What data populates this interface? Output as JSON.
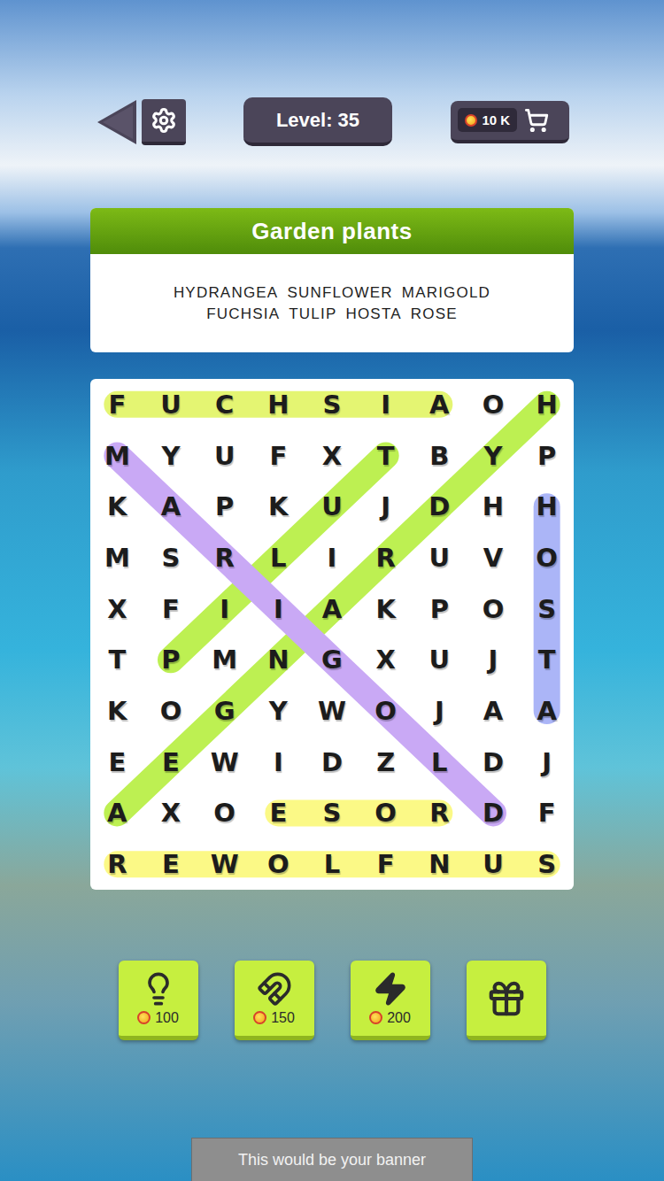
{
  "level": {
    "label": "Level: 35"
  },
  "coins": {
    "amount": "10 K"
  },
  "puzzle": {
    "title": "Garden plants",
    "word_rows": [
      [
        "HYDRANGEA",
        "SUNFLOWER",
        "MARIGOLD"
      ],
      [
        "FUCHSIA",
        "TULIP",
        "HOSTA",
        "ROSE"
      ]
    ]
  },
  "grid": {
    "rows": [
      "FUCHSIAOH",
      "MYUFXTBYP",
      "KAPKUJDHH",
      "MSRLIRUVO",
      "XFIIAKPOS",
      "TPMNGXUJT",
      "KOGYWOJAA",
      "EEWIDZLDJ",
      "AXOESORDF",
      "REWOLFNUS"
    ]
  },
  "found": [
    {
      "word": "FUCHSIA",
      "start": [
        0,
        0
      ],
      "end": [
        0,
        6
      ],
      "color": "#e4f572"
    },
    {
      "word": "HYDRANGEA",
      "start": [
        0,
        8
      ],
      "end": [
        8,
        0
      ],
      "color": "#bdf052"
    },
    {
      "word": "TULIP",
      "start": [
        1,
        5
      ],
      "end": [
        5,
        1
      ],
      "color": "#bdf052"
    },
    {
      "word": "MARIGOLD",
      "start": [
        1,
        0
      ],
      "end": [
        8,
        7
      ],
      "color": "#c9a9f5"
    },
    {
      "word": "HOSTA",
      "start": [
        2,
        8
      ],
      "end": [
        6,
        8
      ],
      "color": "#abb5f7"
    },
    {
      "word": "ROSE",
      "start": [
        8,
        6
      ],
      "end": [
        8,
        3
      ],
      "color": "#fbf986"
    },
    {
      "word": "SUNFLOWER",
      "start": [
        9,
        8
      ],
      "end": [
        9,
        0
      ],
      "color": "#fbf986"
    }
  ],
  "tools": [
    {
      "kind": "hint",
      "cost": "100"
    },
    {
      "kind": "magnet",
      "cost": "150"
    },
    {
      "kind": "bolt",
      "cost": "200"
    },
    {
      "kind": "gift",
      "cost": ""
    }
  ],
  "banner": {
    "text": "This would be your banner"
  }
}
